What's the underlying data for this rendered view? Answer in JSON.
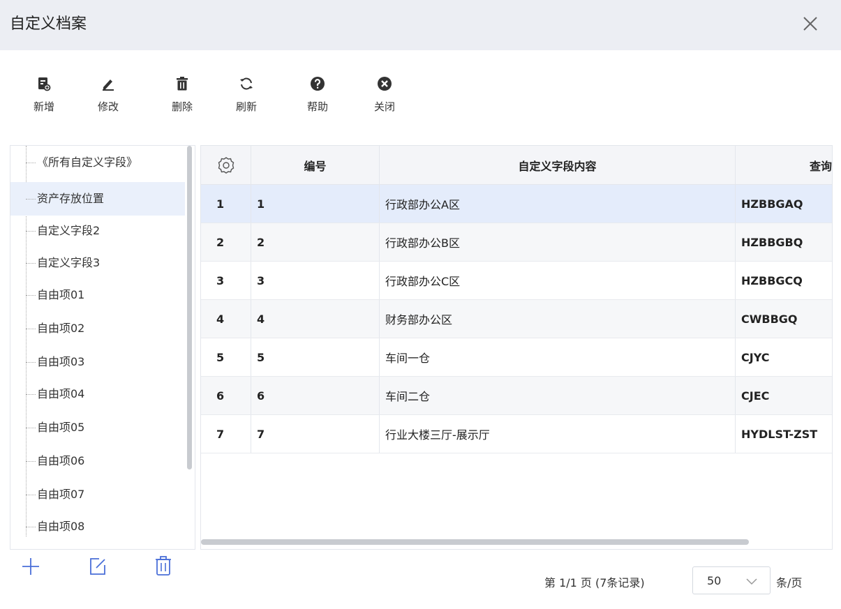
{
  "window": {
    "title": "自定义档案"
  },
  "toolbar": {
    "new": "新增",
    "edit": "修改",
    "delete": "删除",
    "refresh": "刷新",
    "help": "帮助",
    "close": "关闭"
  },
  "tree": {
    "items": [
      "《所有自定义字段》",
      "资产存放位置",
      "自定义字段2",
      "自定义字段3",
      "自由项01",
      "自由项02",
      "自由项03",
      "自由项04",
      "自由项05",
      "自由项06",
      "自由项07",
      "自由项08"
    ],
    "selected_index": 1
  },
  "grid": {
    "columns": {
      "code": "编号",
      "content": "自定义字段内容",
      "query": "查询"
    },
    "rows": [
      {
        "idx": "1",
        "code": "1",
        "content": "行政部办公A区",
        "query": "HZBBGAQ"
      },
      {
        "idx": "2",
        "code": "2",
        "content": "行政部办公B区",
        "query": "HZBBGBQ"
      },
      {
        "idx": "3",
        "code": "3",
        "content": "行政部办公C区",
        "query": "HZBBGCQ"
      },
      {
        "idx": "4",
        "code": "4",
        "content": "财务部办公区",
        "query": "CWBBGQ"
      },
      {
        "idx": "5",
        "code": "5",
        "content": "车间一仓",
        "query": "CJYC"
      },
      {
        "idx": "6",
        "code": "6",
        "content": "车间二仓",
        "query": "CJEC"
      },
      {
        "idx": "7",
        "code": "7",
        "content": "行业大楼三厅-展示厅",
        "query": "HYDLST-ZST"
      }
    ],
    "selected_index": 0
  },
  "pager": {
    "info": "第 1/1 页 (7条记录)",
    "page_size": "50",
    "unit": "条/页"
  },
  "colors": {
    "accent": "#e4ecfb",
    "titlebar": "#eceef3"
  }
}
